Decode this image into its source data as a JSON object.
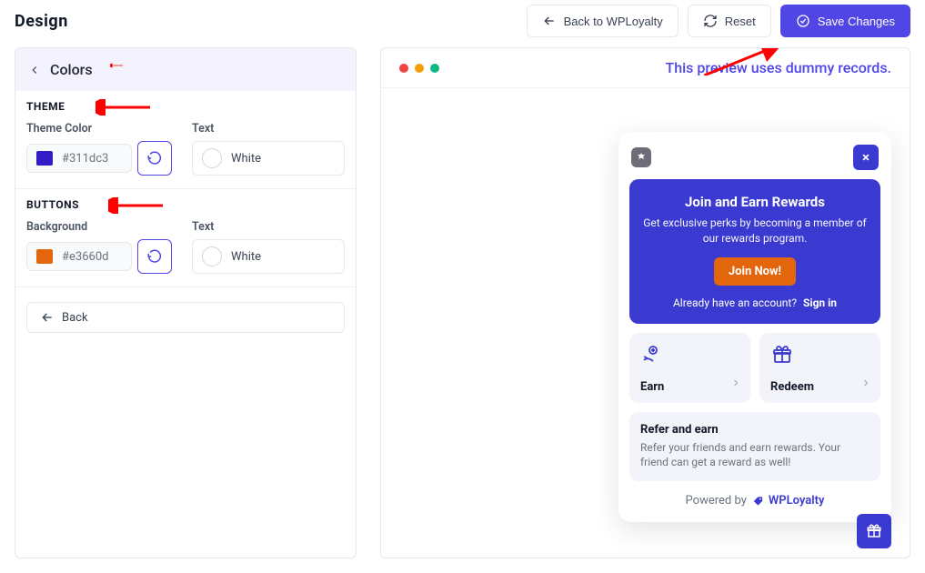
{
  "header": {
    "title": "Design",
    "back_label": "Back to WPLoyalty",
    "reset_label": "Reset",
    "save_label": "Save Changes"
  },
  "sidebar": {
    "header_label": "Colors",
    "sections": {
      "theme": {
        "heading": "THEME",
        "color_label": "Theme Color",
        "color_value": "#311dc3",
        "color_hex": "#311dc3",
        "text_label": "Text",
        "text_value": "White"
      },
      "buttons": {
        "heading": "BUTTONS",
        "bg_label": "Background",
        "bg_value": "#e3660d",
        "bg_hex": "#e3660d",
        "text_label": "Text",
        "text_value": "White"
      }
    },
    "back_label": "Back"
  },
  "preview": {
    "note": "This preview uses dummy records.",
    "widget": {
      "close": "×",
      "hero_title": "Join and Earn Rewards",
      "hero_desc": "Get exclusive perks by becoming a member of our rewards program.",
      "cta_label": "Join Now!",
      "already_text": "Already have an account?",
      "sign_in": "Sign in",
      "earn_label": "Earn",
      "redeem_label": "Redeem",
      "refer_title": "Refer and earn",
      "refer_desc": "Refer your friends and earn rewards. Your friend can get a reward as well!",
      "powered_text": "Powered by",
      "brand": "WPLoyalty"
    }
  }
}
